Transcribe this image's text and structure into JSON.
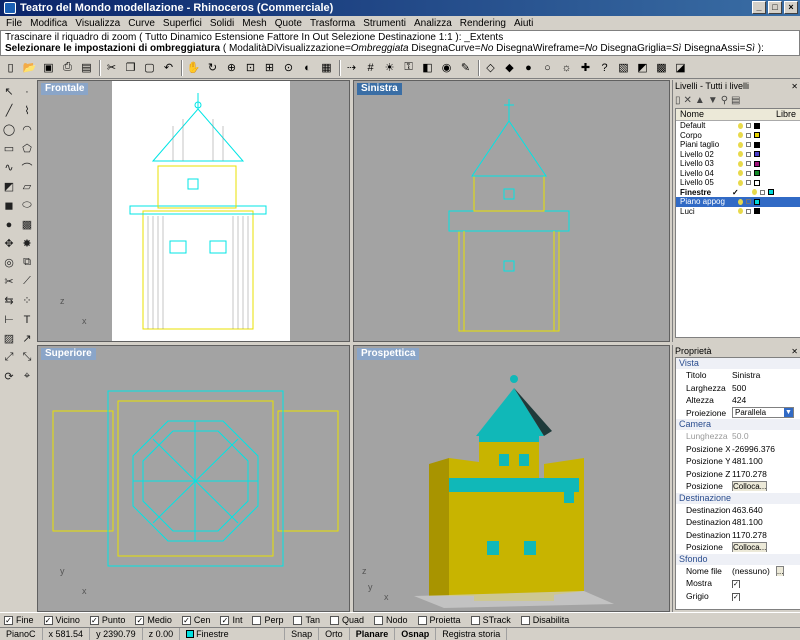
{
  "window": {
    "title": "Teatro del Mondo modellazione - Rhinoceros (Commerciale)",
    "controls": [
      "_",
      "□",
      "×"
    ]
  },
  "menu": [
    "File",
    "Modifica",
    "Visualizza",
    "Curve",
    "Superfici",
    "Solidi",
    "Mesh",
    "Quote",
    "Trasforma",
    "Strumenti",
    "Analizza",
    "Rendering",
    "Aiuti"
  ],
  "command": {
    "line1": "Trascinare il riquadro di zoom ( Tutto  Dinamico  Estensione  Fattore  In  Out  Selezione  Destinazione  1:1 ): _Extents",
    "prompt": "Selezionare le impostazioni di ombreggiatura",
    "options": [
      {
        "name": "ModalitàDiVisualizzazione",
        "value": "Ombreggiata"
      },
      {
        "name": "DisegnaCurve",
        "value": "No"
      },
      {
        "name": "DisegnaWireframe",
        "value": "No"
      },
      {
        "name": "DisegnaGriglia",
        "value": "Sì"
      },
      {
        "name": "DisegnaAssi",
        "value": "Sì"
      }
    ]
  },
  "viewports": {
    "frontale": {
      "label": "Frontale",
      "axes": [
        "z",
        "x"
      ]
    },
    "sinistra": {
      "label": "Sinistra",
      "axes": [
        "z",
        "y"
      ]
    },
    "superiore": {
      "label": "Superiore",
      "axes": [
        "y",
        "x"
      ]
    },
    "prospettica": {
      "label": "Prospettica",
      "axes": [
        "z",
        "y",
        "x"
      ]
    }
  },
  "layers": {
    "title": "Livelli - Tutti i livelli",
    "columns": [
      "Nome",
      "Libre"
    ],
    "items": [
      {
        "name": "Default",
        "color": "#000000"
      },
      {
        "name": "Corpo",
        "color": "#e8d300"
      },
      {
        "name": "Piani taglio",
        "color": "#000000"
      },
      {
        "name": "Livello 02",
        "color": "#4b3ec8"
      },
      {
        "name": "Livello 03",
        "color": "#a0147a"
      },
      {
        "name": "Livello 04",
        "color": "#138a26"
      },
      {
        "name": "Livello 05",
        "color": "#ffffff"
      },
      {
        "name": "Finestre",
        "color": "#00d8d8",
        "current": true
      },
      {
        "name": "Piano appog",
        "color": "#00d8d8",
        "selected": true
      },
      {
        "name": "Luci",
        "color": "#000000"
      }
    ]
  },
  "properties": {
    "title": "Proprietà",
    "sections": [
      {
        "name": "Vista",
        "rows": [
          {
            "key": "Titolo",
            "value": "Sinistra"
          },
          {
            "key": "Larghezza",
            "value": "500"
          },
          {
            "key": "Altezza",
            "value": "424"
          },
          {
            "key": "Proiezione",
            "value": "Parallela",
            "type": "select"
          }
        ]
      },
      {
        "name": "Camera",
        "rows": [
          {
            "key": "Lunghezza foc...",
            "value": "50.0",
            "disabled": true
          },
          {
            "key": "Posizione X",
            "value": "-26996.376"
          },
          {
            "key": "Posizione Y",
            "value": "481.100"
          },
          {
            "key": "Posizione Z",
            "value": "1170.278"
          },
          {
            "key": "Posizione",
            "value": "Colloca...",
            "type": "button"
          }
        ]
      },
      {
        "name": "Destinazione",
        "rows": [
          {
            "key": "Destinazione X",
            "value": "463.640"
          },
          {
            "key": "Destinazione Y",
            "value": "481.100"
          },
          {
            "key": "Destinazione Z",
            "value": "1170.278"
          },
          {
            "key": "Posizione",
            "value": "Colloca...",
            "type": "button"
          }
        ]
      },
      {
        "name": "Sfondo",
        "rows": [
          {
            "key": "Nome file",
            "value": "(nessuno)",
            "extra": "..."
          },
          {
            "key": "Mostra",
            "value": "",
            "type": "check",
            "checked": true
          },
          {
            "key": "Grigio",
            "value": "",
            "type": "check",
            "checked": true
          }
        ]
      }
    ]
  },
  "osnap": [
    {
      "label": "Fine",
      "checked": true
    },
    {
      "label": "Vicino",
      "checked": true
    },
    {
      "label": "Punto",
      "checked": true
    },
    {
      "label": "Medio",
      "checked": true
    },
    {
      "label": "Cen",
      "checked": true
    },
    {
      "label": "Int",
      "checked": true
    },
    {
      "label": "Perp",
      "checked": false
    },
    {
      "label": "Tan",
      "checked": false
    },
    {
      "label": "Quad",
      "checked": false
    },
    {
      "label": "Nodo",
      "checked": false
    },
    {
      "label": "Proietta",
      "checked": false
    },
    {
      "label": "STrack",
      "checked": false
    },
    {
      "label": "Disabilita",
      "checked": false
    }
  ],
  "status": {
    "cplane": "PianoC",
    "x": "x 581.54",
    "y": "y 2390.79",
    "z": "z 0.00",
    "layer": "Finestre",
    "snap": "Snap",
    "orto": "Orto",
    "planare": "Planare",
    "osnap": "Osnap",
    "history": "Registra storia"
  },
  "colors": {
    "wire_cyan": "#00e5e5",
    "wire_yellow": "#e8e000",
    "solid_yellow": "#c8b400",
    "solid_cyan": "#10b8b8",
    "viewport_bg": "#a3a3a3",
    "active_label": "#3a6ea5"
  }
}
